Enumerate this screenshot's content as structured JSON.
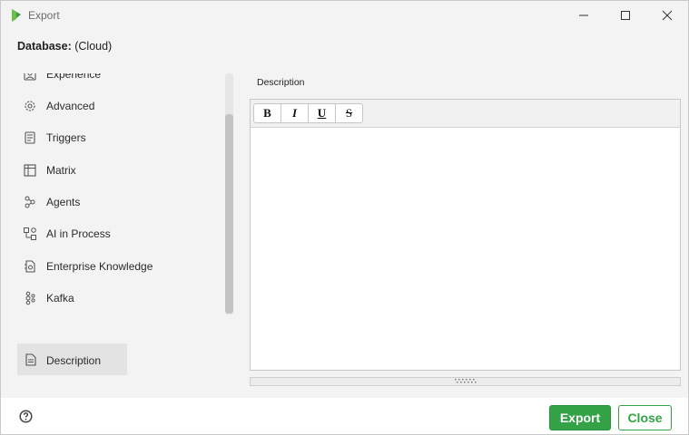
{
  "window": {
    "title": "Export",
    "controls": [
      "minimize-icon",
      "maximize-icon",
      "close-icon"
    ]
  },
  "header": {
    "database_label": "Database:",
    "database_value": "(Cloud)"
  },
  "sidebar": {
    "items": [
      {
        "label": "Experience",
        "icon": "experience-icon"
      },
      {
        "label": "Advanced",
        "icon": "gear-icon"
      },
      {
        "label": "Triggers",
        "icon": "triggers-icon"
      },
      {
        "label": "Matrix",
        "icon": "matrix-icon"
      },
      {
        "label": "Agents",
        "icon": "agents-icon"
      },
      {
        "label": "AI in Process",
        "icon": "ai-process-icon"
      },
      {
        "label": "Enterprise Knowledge",
        "icon": "enterprise-knowledge-icon"
      },
      {
        "label": "Kafka",
        "icon": "kafka-icon"
      }
    ],
    "selected": {
      "label": "Description",
      "icon": "document-icon"
    }
  },
  "editor": {
    "label": "Description",
    "toolbar": {
      "bold": "B",
      "italic": "I",
      "underline": "U",
      "strike": "S"
    },
    "content": ""
  },
  "footer": {
    "export_label": "Export",
    "close_label": "Close",
    "accent_color": "#34a347"
  }
}
